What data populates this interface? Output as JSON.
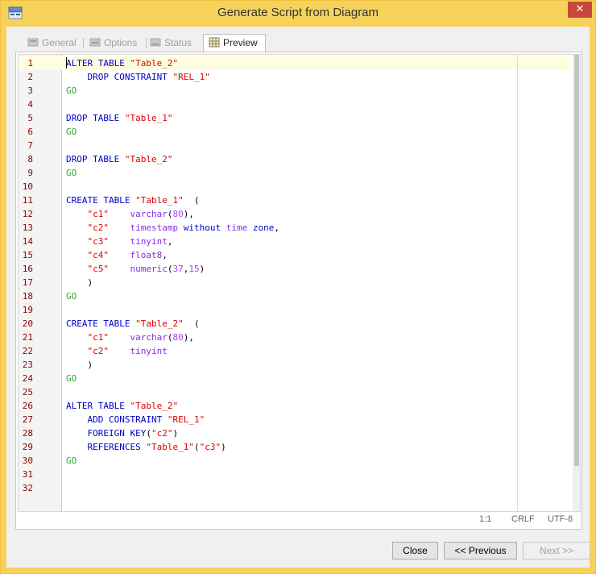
{
  "window": {
    "title": "Generate Script from Diagram",
    "close_glyph": "✕"
  },
  "tabs": [
    {
      "label": "General",
      "icon": "general-icon",
      "active": false
    },
    {
      "label": "Options",
      "icon": "options-icon",
      "active": false
    },
    {
      "label": "Status",
      "icon": "status-icon",
      "active": false
    },
    {
      "label": "Preview",
      "icon": "preview-icon",
      "active": true
    }
  ],
  "editor": {
    "lines": [
      {
        "n": "1",
        "tokens": [
          [
            "kw",
            "ALTER TABLE "
          ],
          [
            "str",
            "\"Table_2\""
          ]
        ]
      },
      {
        "n": "2",
        "tokens": [
          [
            "plain",
            "    "
          ],
          [
            "kw",
            "DROP CONSTRAINT "
          ],
          [
            "str",
            "\"REL_1\""
          ]
        ]
      },
      {
        "n": "3",
        "tokens": [
          [
            "go",
            "GO"
          ]
        ]
      },
      {
        "n": "4",
        "tokens": []
      },
      {
        "n": "5",
        "tokens": [
          [
            "kw",
            "DROP TABLE "
          ],
          [
            "str",
            "\"Table_1\""
          ]
        ]
      },
      {
        "n": "6",
        "tokens": [
          [
            "go",
            "GO"
          ]
        ]
      },
      {
        "n": "7",
        "tokens": []
      },
      {
        "n": "8",
        "tokens": [
          [
            "kw",
            "DROP TABLE "
          ],
          [
            "str",
            "\"Table_2\""
          ]
        ]
      },
      {
        "n": "9",
        "tokens": [
          [
            "go",
            "GO"
          ]
        ]
      },
      {
        "n": "10",
        "tokens": []
      },
      {
        "n": "11",
        "tokens": [
          [
            "kw",
            "CREATE TABLE "
          ],
          [
            "str",
            "\"Table_1\""
          ],
          [
            "plain",
            "  ("
          ]
        ]
      },
      {
        "n": "12",
        "tokens": [
          [
            "plain",
            "    "
          ],
          [
            "str",
            "\"c1\""
          ],
          [
            "plain",
            "    "
          ],
          [
            "type",
            "varchar"
          ],
          [
            "plain",
            "("
          ],
          [
            "num",
            "80"
          ],
          [
            "plain",
            "),"
          ]
        ]
      },
      {
        "n": "13",
        "tokens": [
          [
            "plain",
            "    "
          ],
          [
            "str",
            "\"c2\""
          ],
          [
            "plain",
            "    "
          ],
          [
            "type",
            "timestamp"
          ],
          [
            "plain",
            " "
          ],
          [
            "kw",
            "without"
          ],
          [
            "plain",
            " "
          ],
          [
            "type",
            "time"
          ],
          [
            "plain",
            " "
          ],
          [
            "kw",
            "zone"
          ],
          [
            "plain",
            ","
          ]
        ]
      },
      {
        "n": "14",
        "tokens": [
          [
            "plain",
            "    "
          ],
          [
            "str",
            "\"c3\""
          ],
          [
            "plain",
            "    "
          ],
          [
            "type",
            "tinyint"
          ],
          [
            "plain",
            ","
          ]
        ]
      },
      {
        "n": "15",
        "tokens": [
          [
            "plain",
            "    "
          ],
          [
            "str",
            "\"c4\""
          ],
          [
            "plain",
            "    "
          ],
          [
            "type",
            "float8"
          ],
          [
            "plain",
            ","
          ]
        ]
      },
      {
        "n": "16",
        "tokens": [
          [
            "plain",
            "    "
          ],
          [
            "str",
            "\"c5\""
          ],
          [
            "plain",
            "    "
          ],
          [
            "type",
            "numeric"
          ],
          [
            "plain",
            "("
          ],
          [
            "num",
            "37"
          ],
          [
            "plain",
            ","
          ],
          [
            "num",
            "15"
          ],
          [
            "plain",
            ")"
          ]
        ]
      },
      {
        "n": "17",
        "tokens": [
          [
            "plain",
            "    )"
          ]
        ]
      },
      {
        "n": "18",
        "tokens": [
          [
            "go",
            "GO"
          ]
        ]
      },
      {
        "n": "19",
        "tokens": []
      },
      {
        "n": "20",
        "tokens": [
          [
            "kw",
            "CREATE TABLE "
          ],
          [
            "str",
            "\"Table_2\""
          ],
          [
            "plain",
            "  ("
          ]
        ]
      },
      {
        "n": "21",
        "tokens": [
          [
            "plain",
            "    "
          ],
          [
            "str",
            "\"c1\""
          ],
          [
            "plain",
            "    "
          ],
          [
            "type",
            "varchar"
          ],
          [
            "plain",
            "("
          ],
          [
            "num",
            "80"
          ],
          [
            "plain",
            "),"
          ]
        ]
      },
      {
        "n": "22",
        "tokens": [
          [
            "plain",
            "    "
          ],
          [
            "str",
            "\"c2\""
          ],
          [
            "plain",
            "    "
          ],
          [
            "type",
            "tinyint"
          ]
        ]
      },
      {
        "n": "23",
        "tokens": [
          [
            "plain",
            "    )"
          ]
        ]
      },
      {
        "n": "24",
        "tokens": [
          [
            "go",
            "GO"
          ]
        ]
      },
      {
        "n": "25",
        "tokens": []
      },
      {
        "n": "26",
        "tokens": [
          [
            "kw",
            "ALTER TABLE "
          ],
          [
            "str",
            "\"Table_2\""
          ]
        ]
      },
      {
        "n": "27",
        "tokens": [
          [
            "plain",
            "    "
          ],
          [
            "kw",
            "ADD CONSTRAINT "
          ],
          [
            "str",
            "\"REL_1\""
          ]
        ]
      },
      {
        "n": "28",
        "tokens": [
          [
            "plain",
            "    "
          ],
          [
            "kw",
            "FOREIGN KEY"
          ],
          [
            "plain",
            "("
          ],
          [
            "str",
            "\"c2\""
          ],
          [
            "plain",
            ")"
          ]
        ]
      },
      {
        "n": "29",
        "tokens": [
          [
            "plain",
            "    "
          ],
          [
            "kw",
            "REFERENCES "
          ],
          [
            "str",
            "\"Table_1\""
          ],
          [
            "plain",
            "("
          ],
          [
            "str",
            "\"c3\""
          ],
          [
            "plain",
            ")"
          ]
        ]
      },
      {
        "n": "30",
        "tokens": [
          [
            "go",
            "GO"
          ]
        ]
      },
      {
        "n": "31",
        "tokens": []
      },
      {
        "n": "32",
        "tokens": []
      }
    ]
  },
  "status": {
    "position": "1:1",
    "line_ending": "CRLF",
    "encoding": "UTF-8"
  },
  "buttons": {
    "close": "Close",
    "previous": "<< Previous",
    "next": "Next >>"
  },
  "colors": {
    "title_bar": "#f7d25a",
    "keyword": "#0000c8",
    "string": "#e00000",
    "go": "#2ea82e",
    "type": "#8a2be2",
    "number": "#b040ff",
    "line_number": "#8b0000"
  }
}
